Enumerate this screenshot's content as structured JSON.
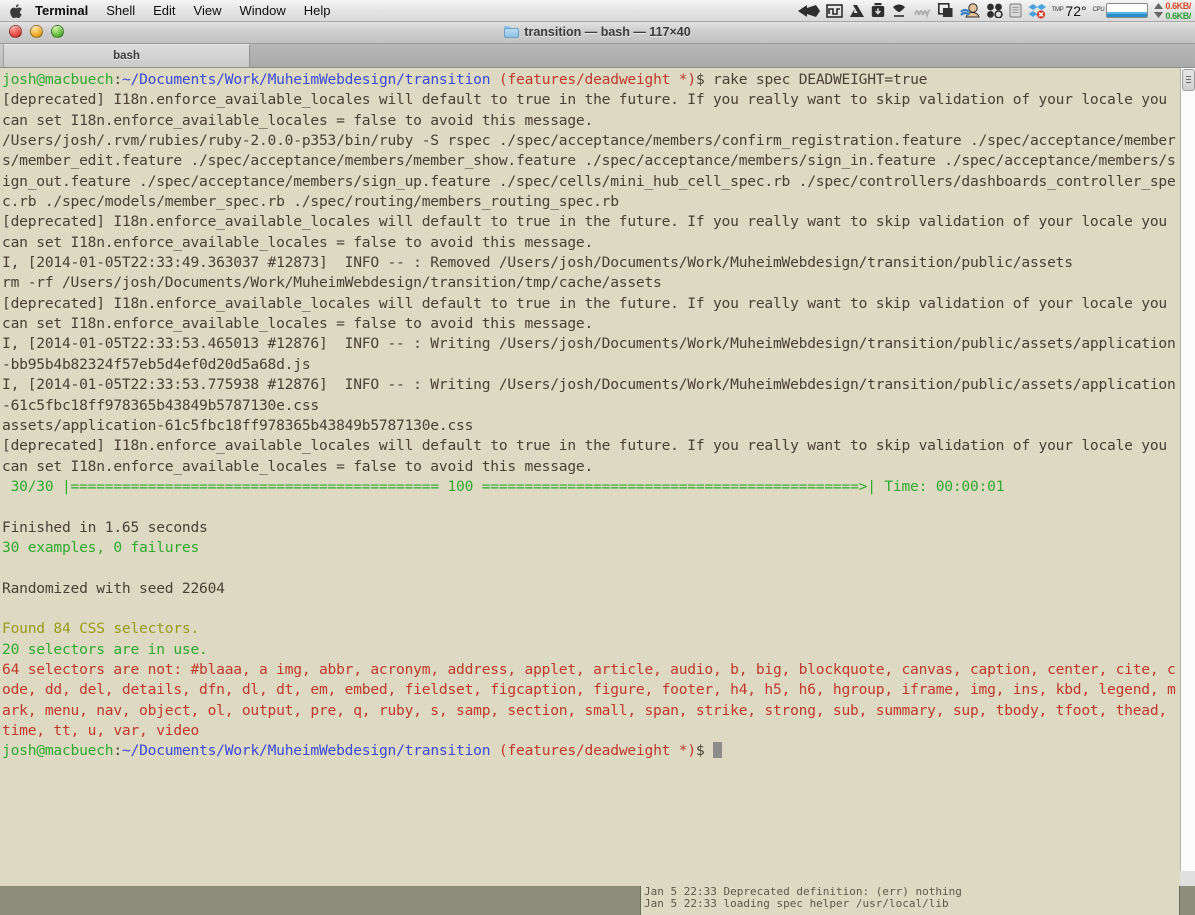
{
  "menubar": {
    "apple_icon": "apple-logo-icon",
    "items": [
      {
        "label": "Terminal",
        "bold": true
      },
      {
        "label": "Shell",
        "bold": false
      },
      {
        "label": "Edit",
        "bold": false
      },
      {
        "label": "View",
        "bold": false
      },
      {
        "label": "Window",
        "bold": false
      },
      {
        "label": "Help",
        "bold": false
      }
    ],
    "status": {
      "temperature": "72°",
      "cpu_label": "CPU",
      "tmp_label": "TMP",
      "net_up": "0.6KB/",
      "net_down": "0.6KB/",
      "icons": [
        "fast-forward-arrows-icon",
        "square-wave-icon",
        "google-drive-icon",
        "backup-box-icon",
        "bartender-icon",
        "spring-icon",
        "window-switch-icon",
        "user-profile-icon",
        "circles-icon",
        "clipboard-icon",
        "dropbox-paused-icon"
      ]
    }
  },
  "window": {
    "title": "transition — bash — 117×40",
    "folder_icon": "folder-icon",
    "traffic_lights": [
      "close-button",
      "minimize-button",
      "zoom-button"
    ],
    "tabs": [
      {
        "label": "bash",
        "active": true
      }
    ]
  },
  "terminal": {
    "colors": {
      "background": "#ddd9c3",
      "foreground": "#4a3f35",
      "green": "#2faa2f",
      "blue": "#3b4ad8",
      "red": "#c0392b",
      "olive": "#9a9a18",
      "cursor": "#8c8c8c"
    },
    "prompt": {
      "user_host": "josh@macbuech",
      "separator": ":",
      "path": "~/Documents/Work/MuheimWebdesign/transition",
      "git_branch": "(features/deadweight *)",
      "sigil": "$"
    },
    "lines": [
      {
        "segments": [
          {
            "t": "josh@macbuech",
            "c": "c-green"
          },
          {
            "t": ":",
            "c": "c-plain"
          },
          {
            "t": "~/Documents/Work/MuheimWebdesign/transition",
            "c": "c-blue"
          },
          {
            "t": " ",
            "c": "c-plain"
          },
          {
            "t": "(features/deadweight *)",
            "c": "c-red"
          },
          {
            "t": "$ rake spec DEADWEIGHT=true",
            "c": "c-plain"
          }
        ]
      },
      {
        "segments": [
          {
            "t": "[deprecated] I18n.enforce_available_locales will default to true in the future. If you really want to skip validation of your locale you can set I18n.enforce_available_locales = false to avoid this message.",
            "c": "c-plain"
          }
        ]
      },
      {
        "segments": [
          {
            "t": "/Users/josh/.rvm/rubies/ruby-2.0.0-p353/bin/ruby -S rspec ./spec/acceptance/members/confirm_registration.feature ./spec/acceptance/members/member_edit.feature ./spec/acceptance/members/member_show.feature ./spec/acceptance/members/sign_in.feature ./spec/acceptance/members/sign_out.feature ./spec/acceptance/members/sign_up.feature ./spec/cells/mini_hub_cell_spec.rb ./spec/controllers/dashboards_controller_spec.rb ./spec/models/member_spec.rb ./spec/routing/members_routing_spec.rb",
            "c": "c-plain"
          }
        ]
      },
      {
        "segments": [
          {
            "t": "[deprecated] I18n.enforce_available_locales will default to true in the future. If you really want to skip validation of your locale you can set I18n.enforce_available_locales = false to avoid this message.",
            "c": "c-plain"
          }
        ]
      },
      {
        "segments": [
          {
            "t": "I, [2014-01-05T22:33:49.363037 #12873]  INFO -- : Removed /Users/josh/Documents/Work/MuheimWebdesign/transition/public/assets",
            "c": "c-plain"
          }
        ]
      },
      {
        "segments": [
          {
            "t": "rm -rf /Users/josh/Documents/Work/MuheimWebdesign/transition/tmp/cache/assets",
            "c": "c-plain"
          }
        ]
      },
      {
        "segments": [
          {
            "t": "[deprecated] I18n.enforce_available_locales will default to true in the future. If you really want to skip validation of your locale you can set I18n.enforce_available_locales = false to avoid this message.",
            "c": "c-plain"
          }
        ]
      },
      {
        "segments": [
          {
            "t": "I, [2014-01-05T22:33:53.465013 #12876]  INFO -- : Writing /Users/josh/Documents/Work/MuheimWebdesign/transition/public/assets/application-bb95b4b82324f57eb5d4ef0d20d5a68d.js",
            "c": "c-plain"
          }
        ]
      },
      {
        "segments": [
          {
            "t": "I, [2014-01-05T22:33:53.775938 #12876]  INFO -- : Writing /Users/josh/Documents/Work/MuheimWebdesign/transition/public/assets/application-61c5fbc18ff978365b43849b5787130e.css",
            "c": "c-plain"
          }
        ]
      },
      {
        "segments": [
          {
            "t": "assets/application-61c5fbc18ff978365b43849b5787130e.css",
            "c": "c-plain"
          }
        ]
      },
      {
        "segments": [
          {
            "t": "[deprecated] I18n.enforce_available_locales will default to true in the future. If you really want to skip validation of your locale you can set I18n.enforce_available_locales = false to avoid this message.",
            "c": "c-plain"
          }
        ]
      },
      {
        "segments": [
          {
            "t": " 30/30 |=========================================== 100 ============================================>| Time: 00:00:01",
            "c": "c-green"
          }
        ]
      },
      {
        "segments": [
          {
            "t": "",
            "c": "c-plain"
          }
        ]
      },
      {
        "segments": [
          {
            "t": "Finished in 1.65 seconds",
            "c": "c-plain"
          }
        ]
      },
      {
        "segments": [
          {
            "t": "30 examples, 0 failures",
            "c": "c-green"
          }
        ]
      },
      {
        "segments": [
          {
            "t": "",
            "c": "c-plain"
          }
        ]
      },
      {
        "segments": [
          {
            "t": "Randomized with seed 22604",
            "c": "c-plain"
          }
        ]
      },
      {
        "segments": [
          {
            "t": "",
            "c": "c-plain"
          }
        ]
      },
      {
        "segments": [
          {
            "t": "Found 84 CSS selectors.",
            "c": "c-olive"
          }
        ]
      },
      {
        "segments": [
          {
            "t": "20 selectors are in use.",
            "c": "c-green"
          }
        ]
      },
      {
        "segments": [
          {
            "t": "64 selectors are not: #blaaa, a img, abbr, acronym, address, applet, article, audio, b, big, blockquote, canvas, caption, center, cite, code, dd, del, details, dfn, dl, dt, em, embed, fieldset, figcaption, figure, footer, h4, h5, h6, hgroup, iframe, img, ins, kbd, legend, mark, menu, nav, object, ol, output, pre, q, ruby, s, samp, section, small, span, strike, strong, sub, summary, sup, tbody, tfoot, thead, time, tt, u, var, video",
            "c": "c-red"
          }
        ]
      }
    ],
    "final_prompt": {
      "segments": [
        {
          "t": "josh@macbuech",
          "c": "c-green"
        },
        {
          "t": ":",
          "c": "c-plain"
        },
        {
          "t": "~/Documents/Work/MuheimWebdesign/transition",
          "c": "c-blue"
        },
        {
          "t": " ",
          "c": "c-plain"
        },
        {
          "t": "(features/deadweight *)",
          "c": "c-red"
        },
        {
          "t": "$ ",
          "c": "c-plain"
        }
      ]
    },
    "test_summary": {
      "progress": "30/30",
      "percent": "100",
      "time": "00:00:01",
      "duration": "1.65 seconds",
      "examples": 30,
      "failures": 0,
      "seed": "22604",
      "selectors_found": 84,
      "selectors_in_use": 20,
      "selectors_unused": 64
    }
  },
  "background_window": {
    "lines": [
      "Jan  5 22:33 Deprecated definition: (err) nothing",
      "Jan  5 22:33 loading spec helper /usr/local/lib"
    ]
  }
}
